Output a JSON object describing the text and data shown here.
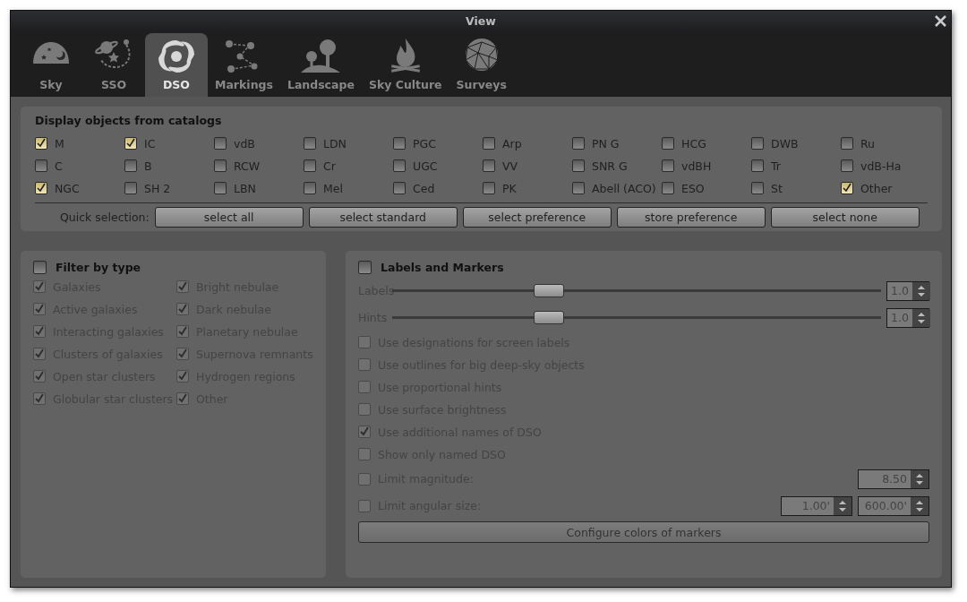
{
  "window": {
    "title": "View"
  },
  "tabs": [
    {
      "label": "Sky",
      "selected": false
    },
    {
      "label": "SSO",
      "selected": false
    },
    {
      "label": "DSO",
      "selected": true
    },
    {
      "label": "Markings",
      "selected": false
    },
    {
      "label": "Landscape",
      "selected": false
    },
    {
      "label": "Sky Culture",
      "selected": false
    },
    {
      "label": "Surveys",
      "selected": false
    }
  ],
  "catalogs": {
    "title": "Display objects from catalogs",
    "items": [
      {
        "label": "M",
        "checked": true
      },
      {
        "label": "IC",
        "checked": true
      },
      {
        "label": "vdB",
        "checked": false
      },
      {
        "label": "LDN",
        "checked": false
      },
      {
        "label": "PGC",
        "checked": false
      },
      {
        "label": "Arp",
        "checked": false
      },
      {
        "label": "PN G",
        "checked": false
      },
      {
        "label": "HCG",
        "checked": false
      },
      {
        "label": "DWB",
        "checked": false
      },
      {
        "label": "Ru",
        "checked": false
      },
      {
        "label": "C",
        "checked": false
      },
      {
        "label": "B",
        "checked": false
      },
      {
        "label": "RCW",
        "checked": false
      },
      {
        "label": "Cr",
        "checked": false
      },
      {
        "label": "UGC",
        "checked": false
      },
      {
        "label": "VV",
        "checked": false
      },
      {
        "label": "SNR G",
        "checked": false
      },
      {
        "label": "vdBH",
        "checked": false
      },
      {
        "label": "Tr",
        "checked": false
      },
      {
        "label": "vdB-Ha",
        "checked": false
      },
      {
        "label": "NGC",
        "checked": true
      },
      {
        "label": "SH 2",
        "checked": false
      },
      {
        "label": "LBN",
        "checked": false
      },
      {
        "label": "Mel",
        "checked": false
      },
      {
        "label": "Ced",
        "checked": false
      },
      {
        "label": "PK",
        "checked": false
      },
      {
        "label": "Abell (ACO)",
        "checked": false
      },
      {
        "label": "ESO",
        "checked": false
      },
      {
        "label": "St",
        "checked": false
      },
      {
        "label": "Other",
        "checked": true
      }
    ],
    "quick_selection": {
      "label": "Quick selection:",
      "buttons": [
        "select all",
        "select standard",
        "select preference",
        "store preference",
        "select none"
      ]
    }
  },
  "filter_by_type": {
    "title": "Filter by type",
    "checked": false,
    "items": [
      {
        "label": "Galaxies",
        "checked": true
      },
      {
        "label": "Bright nebulae",
        "checked": true
      },
      {
        "label": "Active galaxies",
        "checked": true
      },
      {
        "label": "Dark nebulae",
        "checked": true
      },
      {
        "label": "Interacting galaxies",
        "checked": true
      },
      {
        "label": "Planetary nebulae",
        "checked": true
      },
      {
        "label": "Clusters of galaxies",
        "checked": true
      },
      {
        "label": "Supernova remnants",
        "checked": true
      },
      {
        "label": "Open star clusters",
        "checked": true
      },
      {
        "label": "Hydrogen regions",
        "checked": true
      },
      {
        "label": "Globular star clusters",
        "checked": true
      },
      {
        "label": "Other",
        "checked": true
      }
    ]
  },
  "labels_and_markers": {
    "title": "Labels and Markers",
    "checked": false,
    "sliders": [
      {
        "label": "Labels",
        "level": 0.32,
        "value": "1.0"
      },
      {
        "label": "Hints",
        "level": 0.32,
        "value": "1.0"
      }
    ],
    "options": [
      {
        "label": "Use designations for screen labels",
        "checked": false
      },
      {
        "label": "Use outlines for big deep-sky objects",
        "checked": false
      },
      {
        "label": "Use proportional hints",
        "checked": false
      },
      {
        "label": "Use surface brightness",
        "checked": false
      },
      {
        "label": "Use additional names of DSO",
        "checked": true
      },
      {
        "label": "Show only named DSO",
        "checked": false
      }
    ],
    "limits": [
      {
        "label": "Limit magnitude:",
        "checked": false,
        "values": [
          "8.50"
        ]
      },
      {
        "label": "Limit angular size:",
        "checked": false,
        "values": [
          "1.00'",
          "600.00'"
        ]
      }
    ],
    "button": "Configure colors of markers"
  }
}
